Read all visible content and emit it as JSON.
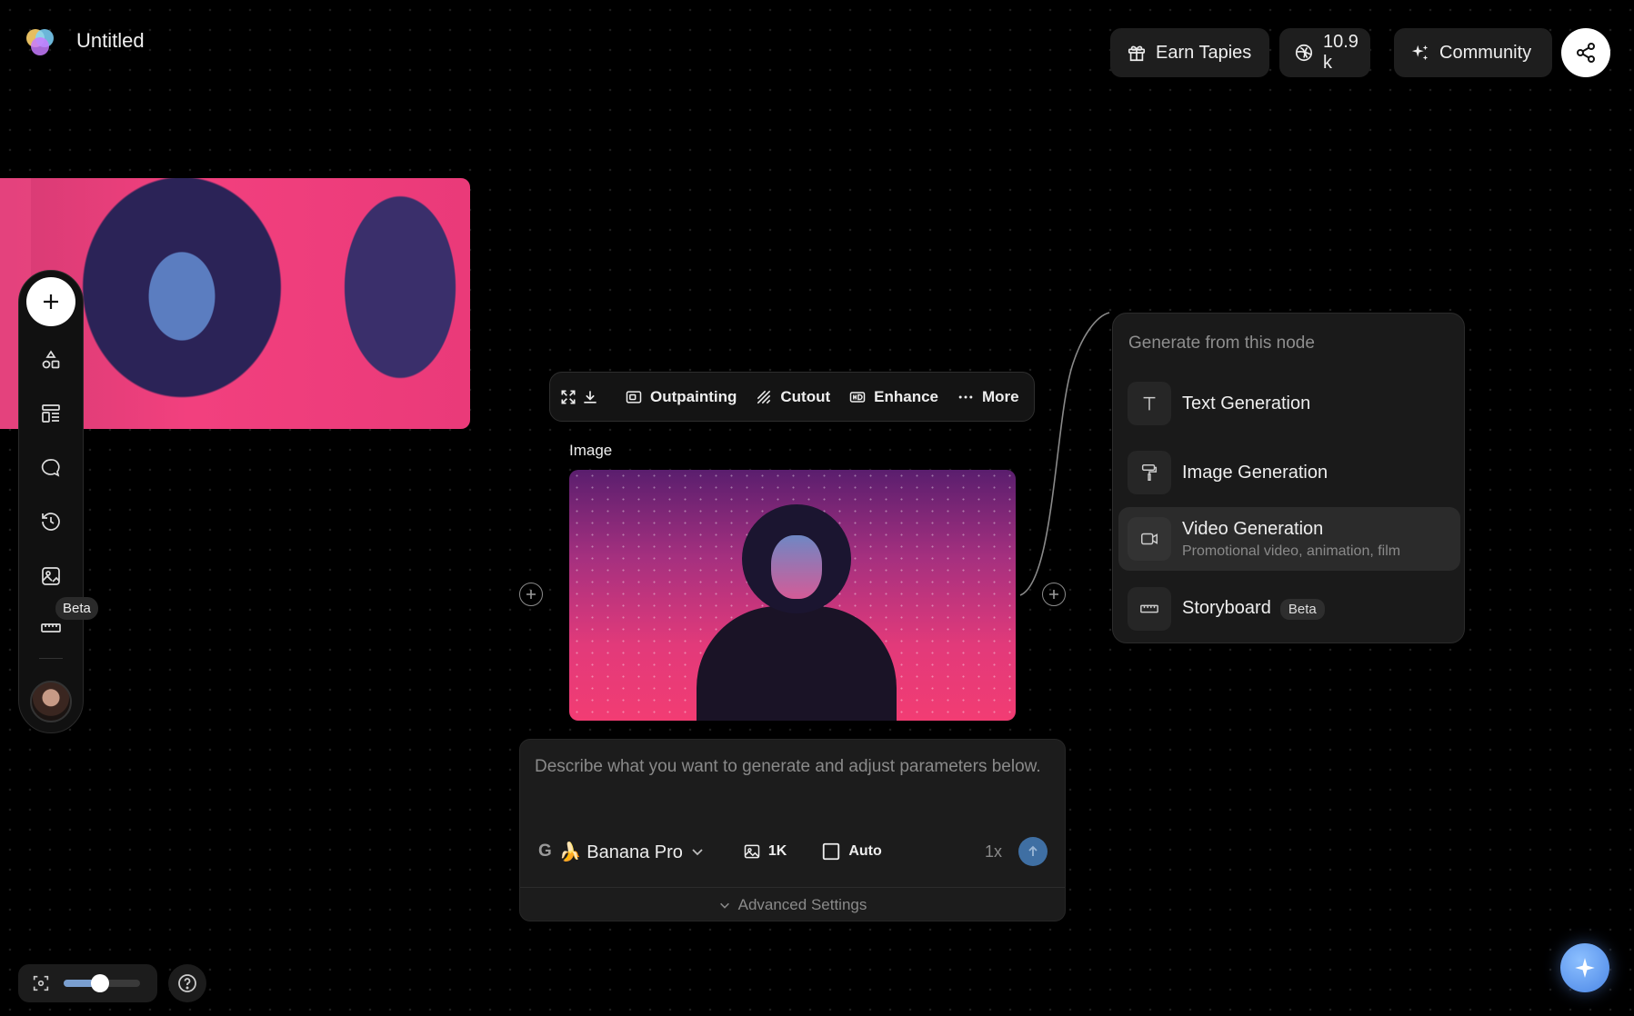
{
  "header": {
    "title": "Untitled",
    "earn_label": "Earn Tapies",
    "credits": "10.9 k",
    "community_label": "Community"
  },
  "toolbar": {
    "beta_tooltip": "Beta"
  },
  "node_toolbar": {
    "outpainting": "Outpainting",
    "cutout": "Cutout",
    "enhance": "Enhance",
    "more": "More"
  },
  "node": {
    "label": "Image"
  },
  "generate_panel": {
    "header": "Generate from this node",
    "items": [
      {
        "title": "Text Generation",
        "icon": "text-icon"
      },
      {
        "title": "Image Generation",
        "icon": "paint-roller-icon"
      },
      {
        "title": "Video Generation",
        "subtitle": "Promotional video, animation, film",
        "icon": "video-icon"
      },
      {
        "title": "Storyboard",
        "badge": "Beta",
        "icon": "storyboard-icon"
      }
    ]
  },
  "prompt": {
    "placeholder": "Describe what you want to generate and adjust parameters below.",
    "model_provider": "G",
    "model_name": "🍌 Banana Pro",
    "resolution": "1K",
    "aspect": "Auto",
    "count": "1x",
    "advanced_label": "Advanced Settings"
  },
  "zoom": {
    "level": 0.4
  },
  "colors": {
    "accent": "#4a86e6",
    "send": "#3f6fa3"
  }
}
